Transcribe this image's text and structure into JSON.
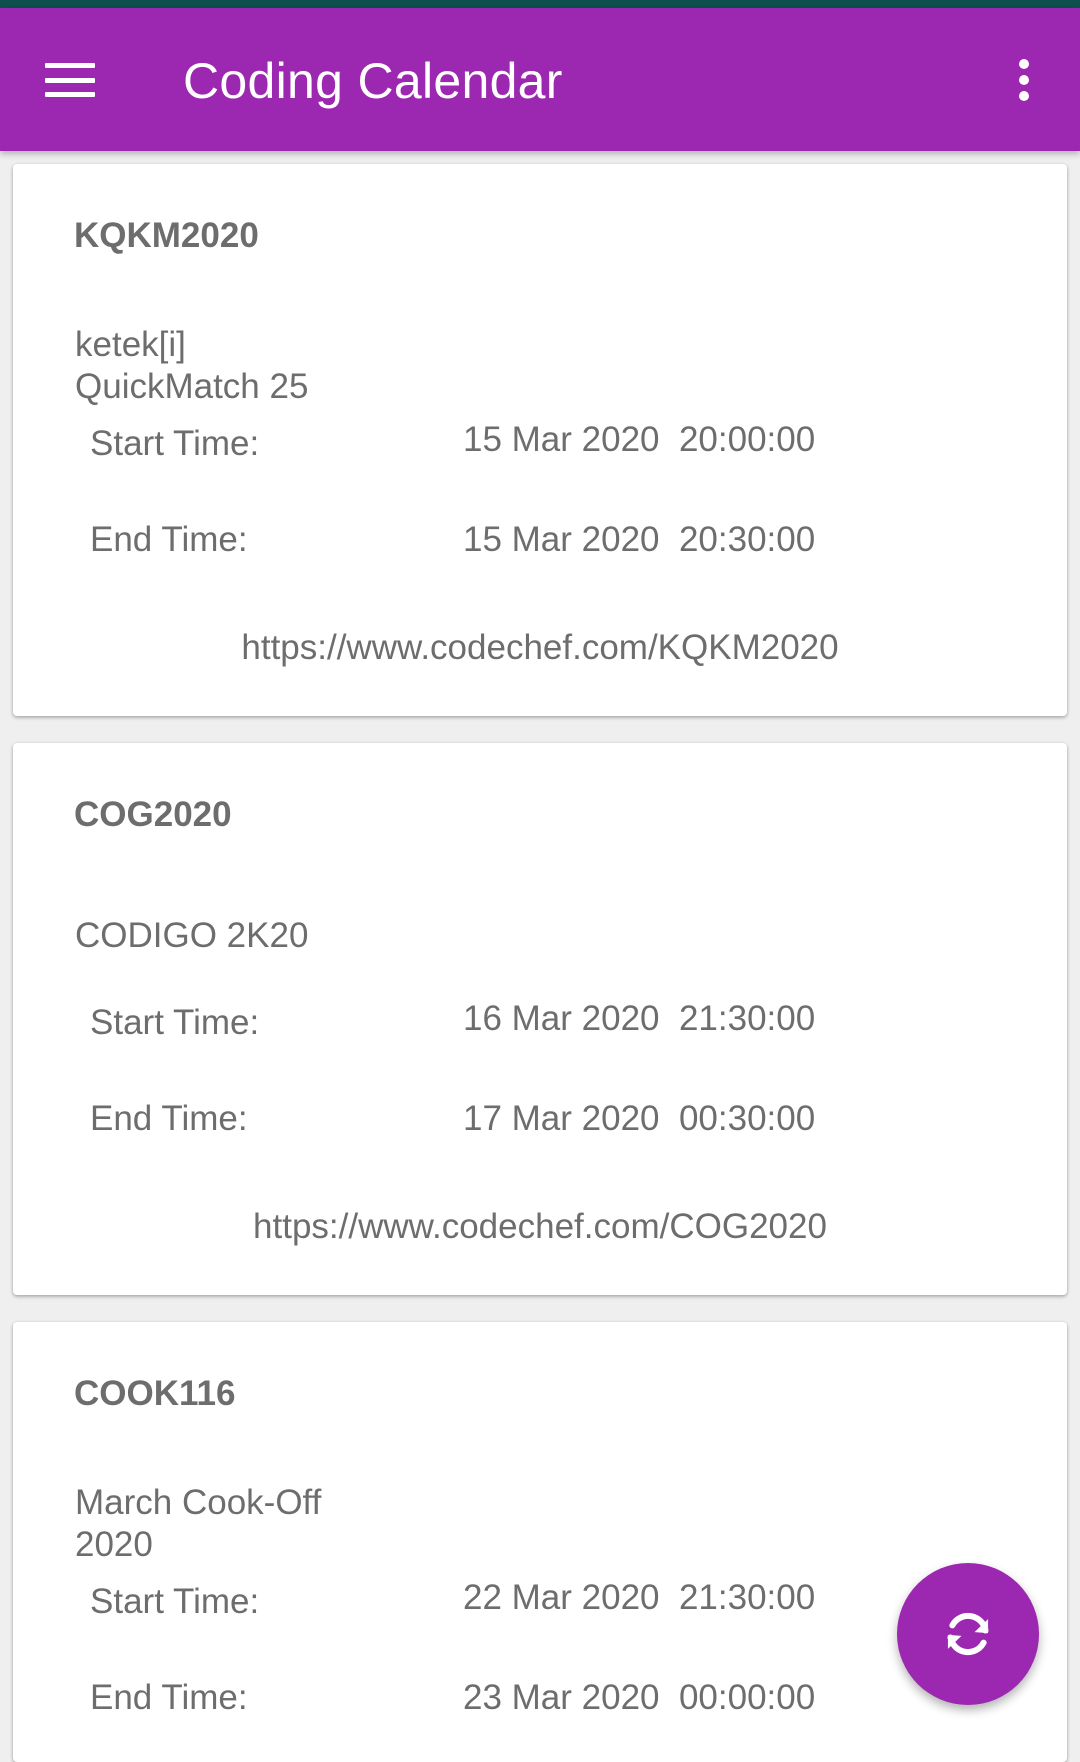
{
  "app_bar": {
    "title": "Coding Calendar",
    "menu_icon": "hamburger-menu-icon",
    "overflow_icon": "more-vertical-icon",
    "color": "#9c27b0"
  },
  "contests": [
    {
      "code": "KQKM2020",
      "name": "ketek[i] QuickMatch 25",
      "start_label": "Start Time:",
      "start_value": "15 Mar 2020  20:00:00",
      "end_label": "End Time:",
      "end_value": "15 Mar 2020  20:30:00",
      "url": "https://www.codechef.com/KQKM2020"
    },
    {
      "code": "COG2020",
      "name": "CODIGO 2K20",
      "start_label": "Start Time:",
      "start_value": "16 Mar 2020  21:30:00",
      "end_label": "End Time:",
      "end_value": "17 Mar 2020  00:30:00",
      "url": "https://www.codechef.com/COG2020"
    },
    {
      "code": "COOK116",
      "name": "March Cook-Off 2020",
      "start_label": "Start Time:",
      "start_value": "22 Mar 2020  21:30:00",
      "end_label": "End Time:",
      "end_value": "23 Mar 2020  00:00:00",
      "url": ""
    }
  ],
  "fab": {
    "icon": "refresh-icon",
    "color": "#9c27b0"
  }
}
